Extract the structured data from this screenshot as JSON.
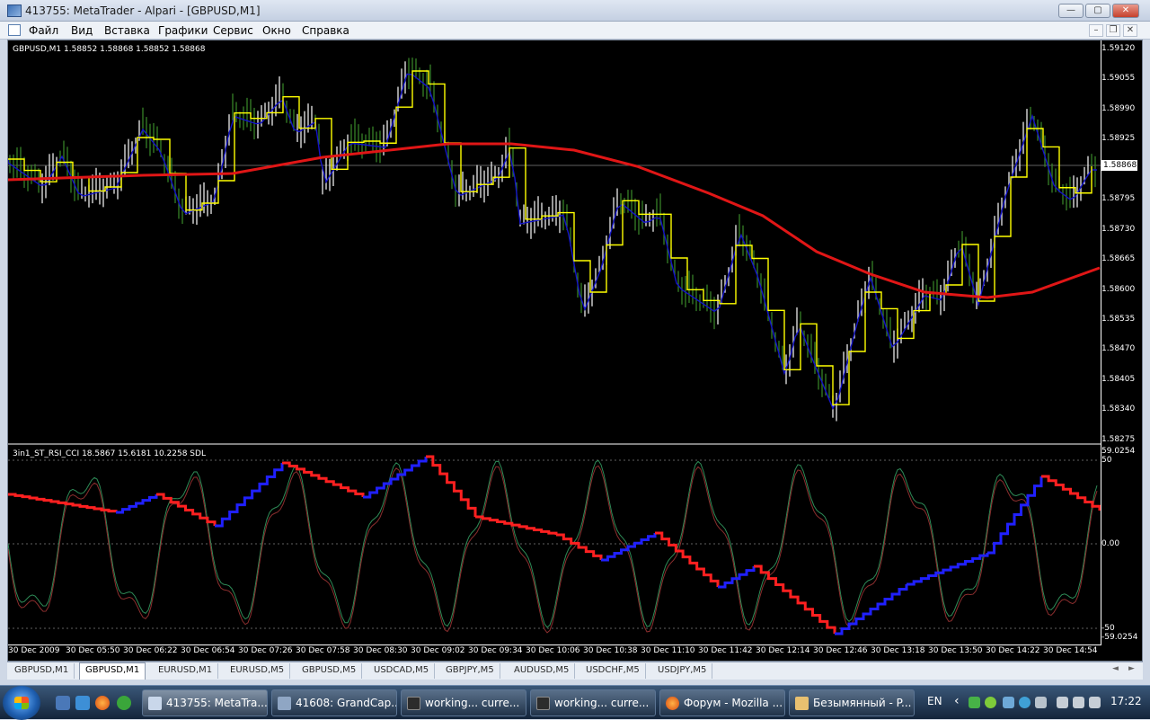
{
  "window": {
    "title": "413755: MetaTrader - Alpari - [GBPUSD,M1]",
    "min": "—",
    "max": "▢",
    "close": "✕"
  },
  "menu": [
    "Файл",
    "Вид",
    "Вставка",
    "Графики",
    "Сервис",
    "Окно",
    "Справка"
  ],
  "mdi": {
    "min": "–",
    "restore": "❐",
    "close": "✕"
  },
  "chart": {
    "price_label": "GBPUSD,M1  1.58852 1.58868 1.58852 1.58868",
    "current_price": "1.58868",
    "price_axis": [
      "1.59120",
      "1.59055",
      "1.58990",
      "1.58925",
      "1.58860",
      "1.58795",
      "1.58730",
      "1.58665",
      "1.58600",
      "1.58535",
      "1.58470",
      "1.58405",
      "1.58340",
      "1.58275"
    ],
    "indicator_label": "3in1_ST_RSI_CCI 18.5867 15.6181 10.2258  SDL",
    "indicator_axis": [
      "59.0254",
      "50",
      "0.00",
      "-50",
      "-59.0254"
    ],
    "time_labels": [
      "30 Dec 2009",
      "30 Dec 05:50",
      "30 Dec 06:22",
      "30 Dec 06:54",
      "30 Dec 07:26",
      "30 Dec 07:58",
      "30 Dec 08:30",
      "30 Dec 09:02",
      "30 Dec 09:34",
      "30 Dec 10:06",
      "30 Dec 10:38",
      "30 Dec 11:10",
      "30 Dec 11:42",
      "30 Dec 12:14",
      "30 Dec 12:46",
      "30 Dec 13:18",
      "30 Dec 13:50",
      "30 Dec 14:22",
      "30 Dec 14:54"
    ],
    "colors": {
      "ma": "#e01616",
      "signal": "#ffff00",
      "candle_up": "#ffffff",
      "bull_line": "#1414c8",
      "osc_green": "#2e8b57",
      "osc_red": "#8b2e2e"
    }
  },
  "tabs": [
    "GBPUSD,M1",
    "GBPUSD,M1",
    "EURUSD,M1",
    "EURUSD,M5",
    "GBPUSD,M5",
    "USDCAD,M5",
    "GBPJPY,M5",
    "AUDUSD,M5",
    "USDCHF,M5",
    "USDJPY,M5"
  ],
  "tabs_active": 1,
  "tab_arrows": [
    "◄",
    "►"
  ],
  "taskbar": {
    "tasks": [
      "413755: MetaTra...",
      "41608: GrandCap...",
      "working...  curre...",
      "working...  curre...",
      "Форум - Mozilla ...",
      "Безымянный - P..."
    ],
    "active": 0,
    "lang": "EN",
    "tray_arrow": "‹",
    "clock": "17:22"
  }
}
